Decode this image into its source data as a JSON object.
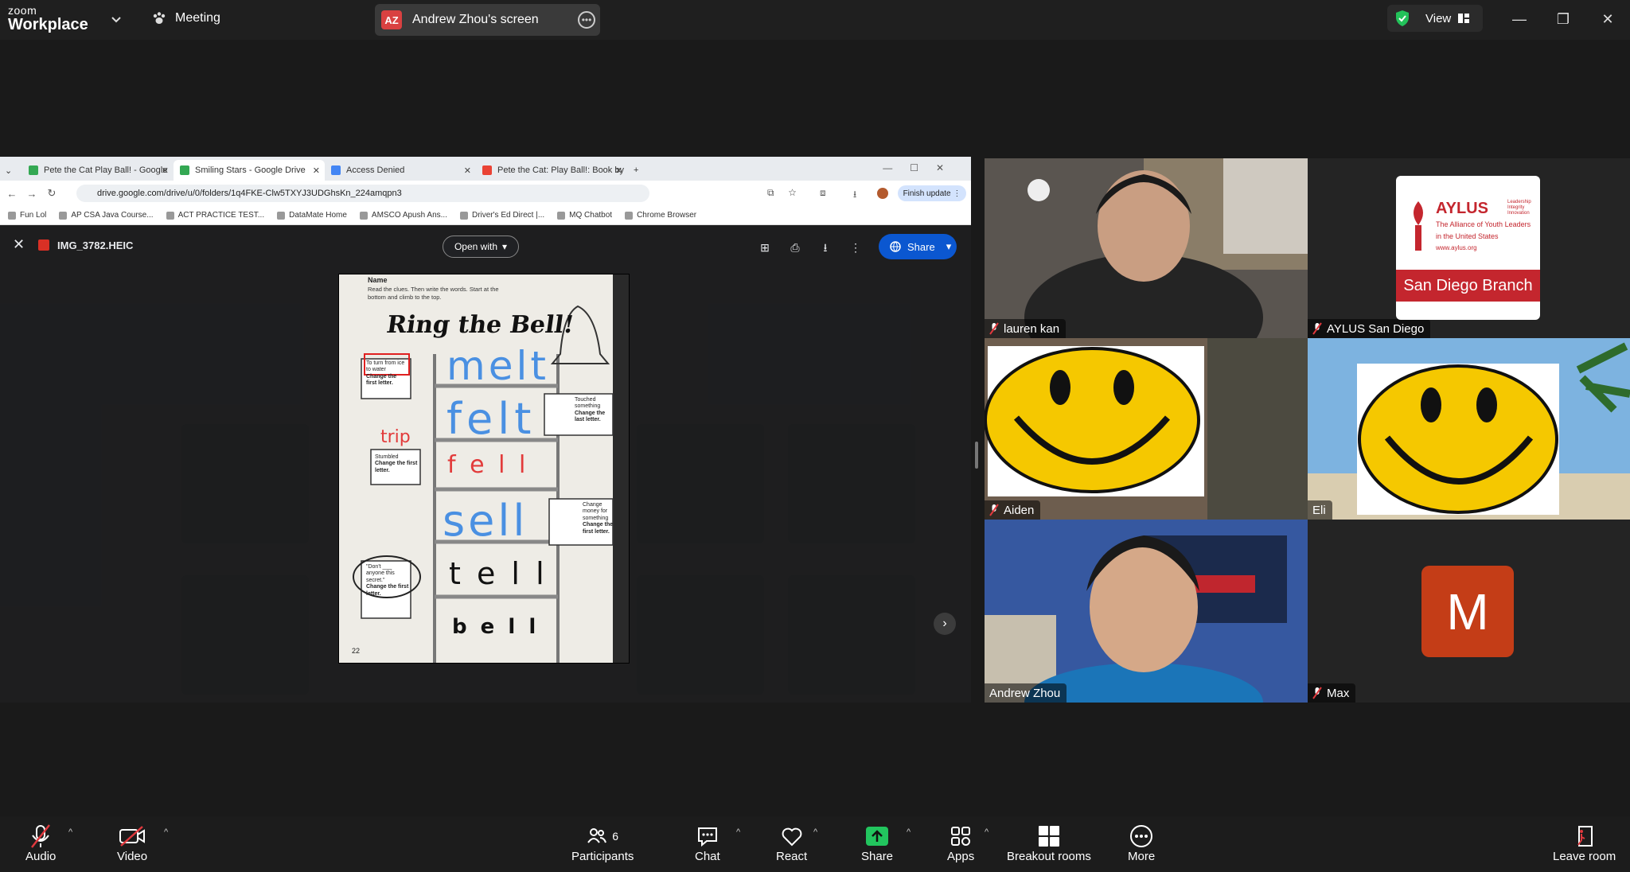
{
  "topbar": {
    "brand_small": "zoom",
    "brand_big": "Workplace",
    "meeting_label": "Meeting",
    "screen_initials": "AZ",
    "screen_label": "Andrew Zhou's screen",
    "view_label": "View"
  },
  "browser": {
    "tabs": [
      {
        "title": "Pete the Cat Play Ball! - Google",
        "fav": "#34a853"
      },
      {
        "title": "Smiling Stars - Google Drive",
        "fav": "#34a853"
      },
      {
        "title": "Access Denied",
        "fav": "#4285f4"
      },
      {
        "title": "Pete the Cat: Play Ball!: Book by",
        "fav": "#ea4335"
      }
    ],
    "url": "drive.google.com/drive/u/0/folders/1q4FKE-Clw5TXYJ3UDGhsKn_224amqpn3",
    "finish_update": "Finish update",
    "bookmarks": [
      "Fun Lol",
      "AP CSA Java Course...",
      "ACT PRACTICE TEST...",
      "DataMate Home",
      "AMSCO Apush Ans...",
      "Driver's Ed Direct |...",
      "MQ Chatbot",
      "Chrome Browser"
    ]
  },
  "viewer": {
    "filename": "IMG_3782.HEIC",
    "open_with": "Open with",
    "share": "Share"
  },
  "worksheet": {
    "name_label": "Name",
    "instructions": "Read the clues. Then write the words. Start at the bottom and climb to the top.",
    "title": "Ring the Bell!",
    "clue1": "To turn from ice to water",
    "clue1_rule": "Change the first letter.",
    "clue2": "Touched something",
    "clue2_rule": "Change the last letter.",
    "clue3": "Stumbled",
    "clue3_rule": "Change the first letter.",
    "clue4": "Change money for something",
    "clue4_rule": "Change the first letter.",
    "clue5": "\"Don't ___ anyone this secret.\"",
    "clue5_rule": "Change the first letter.",
    "answer_melt": "melt",
    "answer_felt": "felt",
    "answer_fell": "f e l l",
    "answer_sell": "sell",
    "answer_tell": "t e l l",
    "answer_bell": "b e l l",
    "note_trip": "trip",
    "page_num": "22"
  },
  "participants": [
    {
      "name": "lauren kan",
      "muted": true
    },
    {
      "name": "AYLUS San Diego",
      "muted": true
    },
    {
      "name": "Aiden",
      "muted": true
    },
    {
      "name": "Eli",
      "muted": false
    },
    {
      "name": "Andrew Zhou",
      "muted": false
    },
    {
      "name": "Max",
      "muted": true
    }
  ],
  "aylus_logo": {
    "line1": "AYLUS",
    "line2": "The Alliance of Youth Leaders in the United States",
    "url": "www.aylus.org",
    "band": "San Diego Branch",
    "tag": "Leadership Integrity Innovation"
  },
  "max_initial": "M",
  "toolbar": {
    "audio": "Audio",
    "video": "Video",
    "participants": "Participants",
    "participants_count": "6",
    "chat": "Chat",
    "react": "React",
    "share": "Share",
    "apps": "Apps",
    "breakout": "Breakout rooms",
    "more": "More",
    "leave": "Leave room"
  },
  "colors": {
    "speaking_border": "#23d959",
    "share_green": "#22c55e",
    "mute_red": "#e0393e",
    "drive_blue": "#0b57d0"
  }
}
